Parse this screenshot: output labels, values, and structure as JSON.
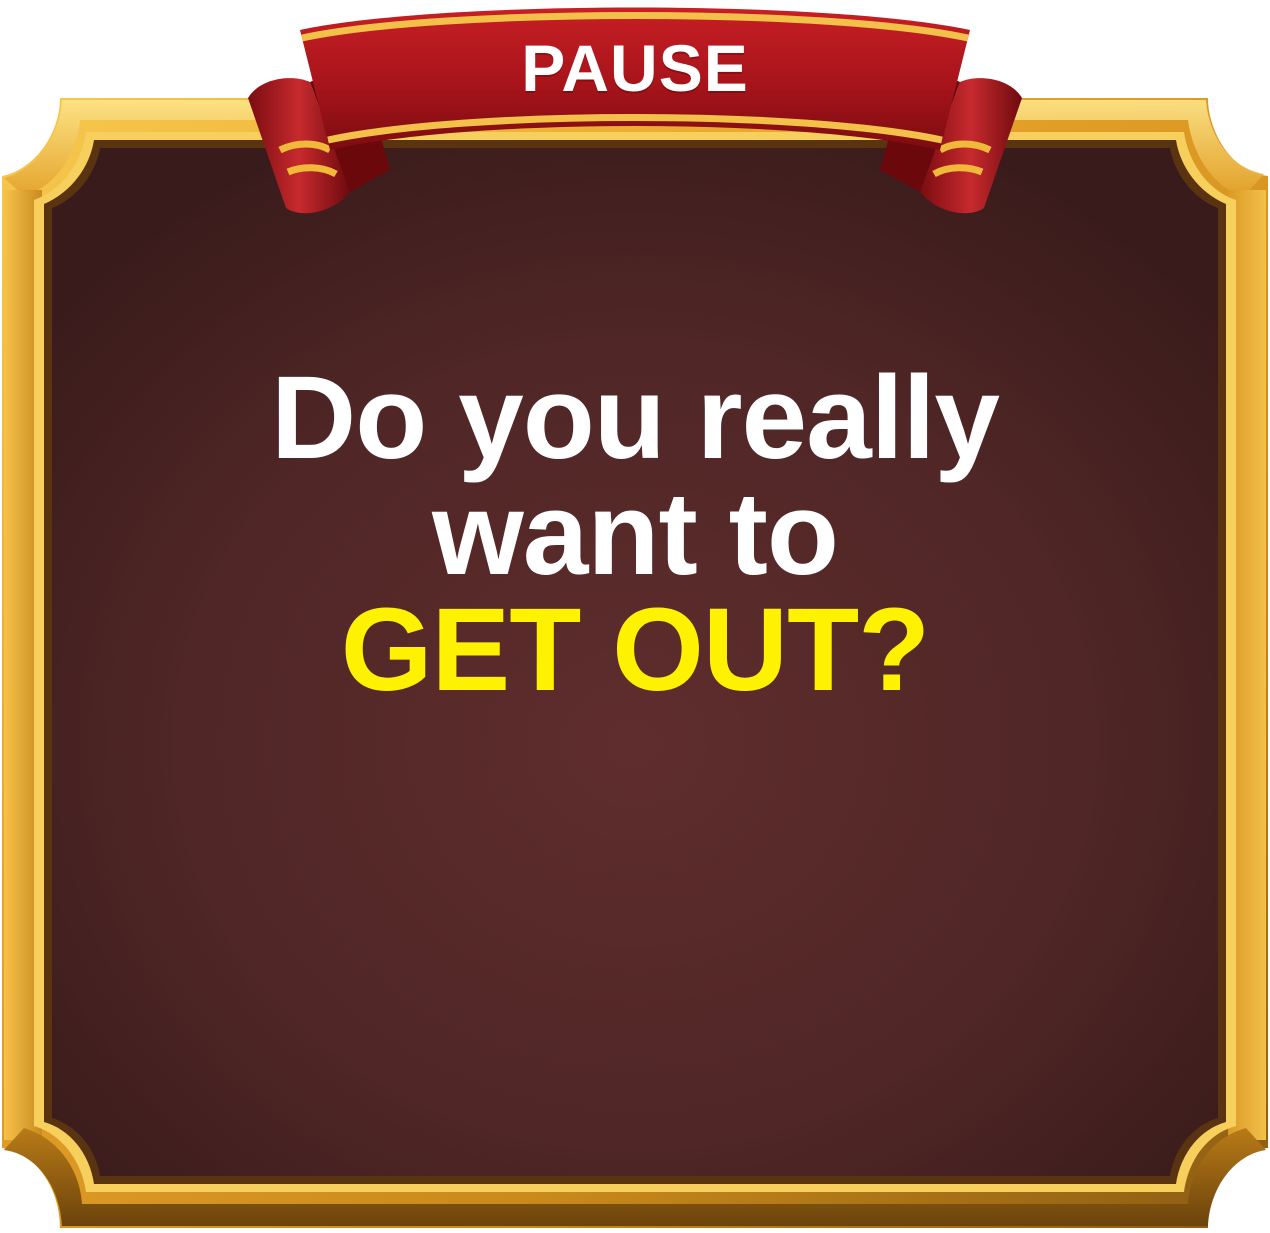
{
  "dialog": {
    "title": "PAUSE",
    "message_lines": [
      "Do you really",
      "want to"
    ],
    "highlight": "GET OUT?"
  },
  "colors": {
    "panel_bg": "#4f2727",
    "frame_gold": "#e6a72c",
    "ribbon_red": "#a8161b",
    "highlight_text": "#fff200",
    "message_text": "#ffffff"
  }
}
